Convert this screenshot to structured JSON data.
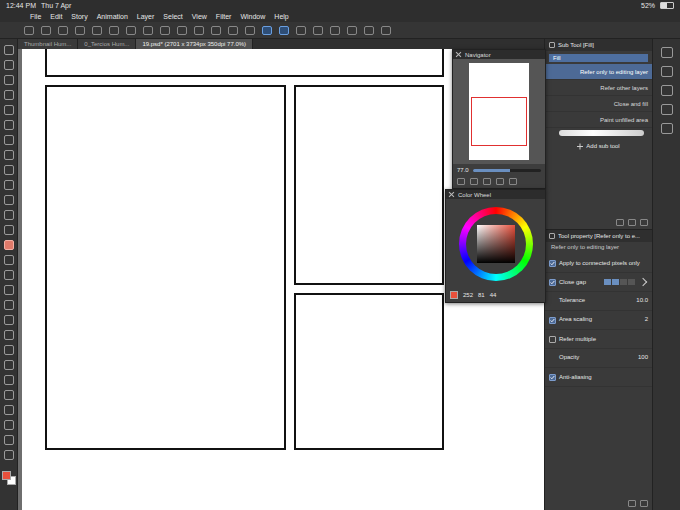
{
  "status_bar": {
    "time": "12:44 PM",
    "date": "Thu 7 Apr",
    "battery": "52%",
    "battery_level": 0.52
  },
  "menu": [
    "File",
    "Edit",
    "Story",
    "Animation",
    "Layer",
    "Select",
    "View",
    "Filter",
    "Window",
    "Help"
  ],
  "tabs": [
    {
      "label": "Thumbnail Hum...",
      "selected": false
    },
    {
      "label": "0_Tercios Hum...",
      "selected": false
    },
    {
      "label": "19.psd* (2701 x 3734px 350dpi 77.0%)",
      "selected": true
    }
  ],
  "navigator": {
    "title": "Navigator",
    "zoom": "77.0",
    "level": 0.55
  },
  "color_wheel": {
    "title": "Color Wheel",
    "values": [
      "252",
      "81",
      "44"
    ],
    "swatches": [
      {
        "color": "#e8503c",
        "selected": true
      },
      {
        "color": "#ffffff",
        "selected": false
      }
    ]
  },
  "sub_tool": {
    "title": "Sub Tool [Fill]",
    "group": "Fill",
    "items": [
      {
        "label": "Refer only to editing layer",
        "selected": true
      },
      {
        "label": "Refer other layers",
        "selected": false
      },
      {
        "label": "Close and fill",
        "selected": false
      },
      {
        "label": "Paint unfilled area",
        "selected": false
      }
    ],
    "add_button": "Add sub tool"
  },
  "tool_property": {
    "title": "Tool property [Refer only to e...",
    "subtitle": "Refer only to editing layer",
    "rows": [
      {
        "kind": "check",
        "label": "Apply to connected pixels only",
        "checked": true
      },
      {
        "kind": "gap",
        "label": "Close gap",
        "checked": true,
        "level": 0.5
      },
      {
        "kind": "number",
        "label": "Tolerance",
        "value": "10.0",
        "level": 0.1
      },
      {
        "kind": "check-number",
        "label": "Area scaling",
        "checked": true,
        "value": "2",
        "level": 0.2
      },
      {
        "kind": "check",
        "label": "Refer multiple",
        "checked": false
      },
      {
        "kind": "number",
        "label": "Opacity",
        "value": "100",
        "level": 1
      },
      {
        "kind": "check",
        "label": "Anti-aliasing",
        "checked": true
      }
    ]
  }
}
